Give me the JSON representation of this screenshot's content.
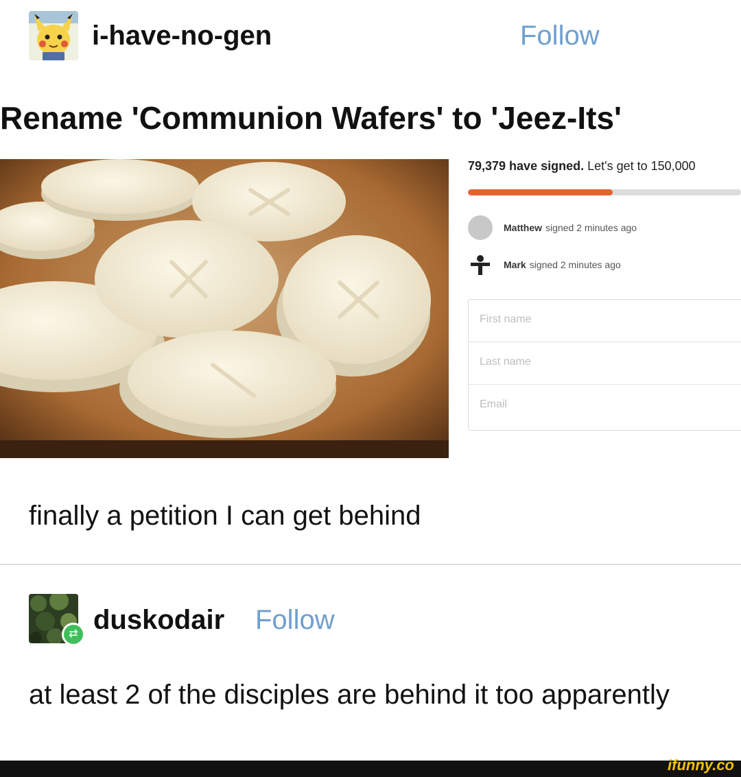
{
  "post": {
    "username": "i-have-no-gen",
    "follow_label": "Follow",
    "title": "Rename 'Communion Wafers' to 'Jeez-Its'",
    "caption": "finally a petition I can get behind"
  },
  "petition": {
    "signed_count": "79,379 have signed.",
    "goal_text": "Let's get to 150,000",
    "progress_fraction": 0.53,
    "signers": [
      {
        "name": "Matthew",
        "action": "signed 2 minutes ago"
      },
      {
        "name": "Mark",
        "action": "signed 2 minutes ago"
      }
    ],
    "fields": [
      {
        "placeholder": "First name"
      },
      {
        "placeholder": "Last name"
      },
      {
        "placeholder": "Email"
      }
    ]
  },
  "reblog": {
    "username": "duskodair",
    "follow_label": "Follow",
    "comment": "at least 2 of the disciples are behind it too apparently"
  },
  "watermark": "ifunny.co",
  "colors": {
    "follow": "#6f9fcf",
    "progress": "#e8622e",
    "reblog_badge": "#3fbf5b",
    "watermark": "#f2c100"
  },
  "icons": {
    "avatar1": "pikachu-avatar-icon",
    "avatar2": "foliage-avatar-icon",
    "reblog": "reblog-icon"
  }
}
